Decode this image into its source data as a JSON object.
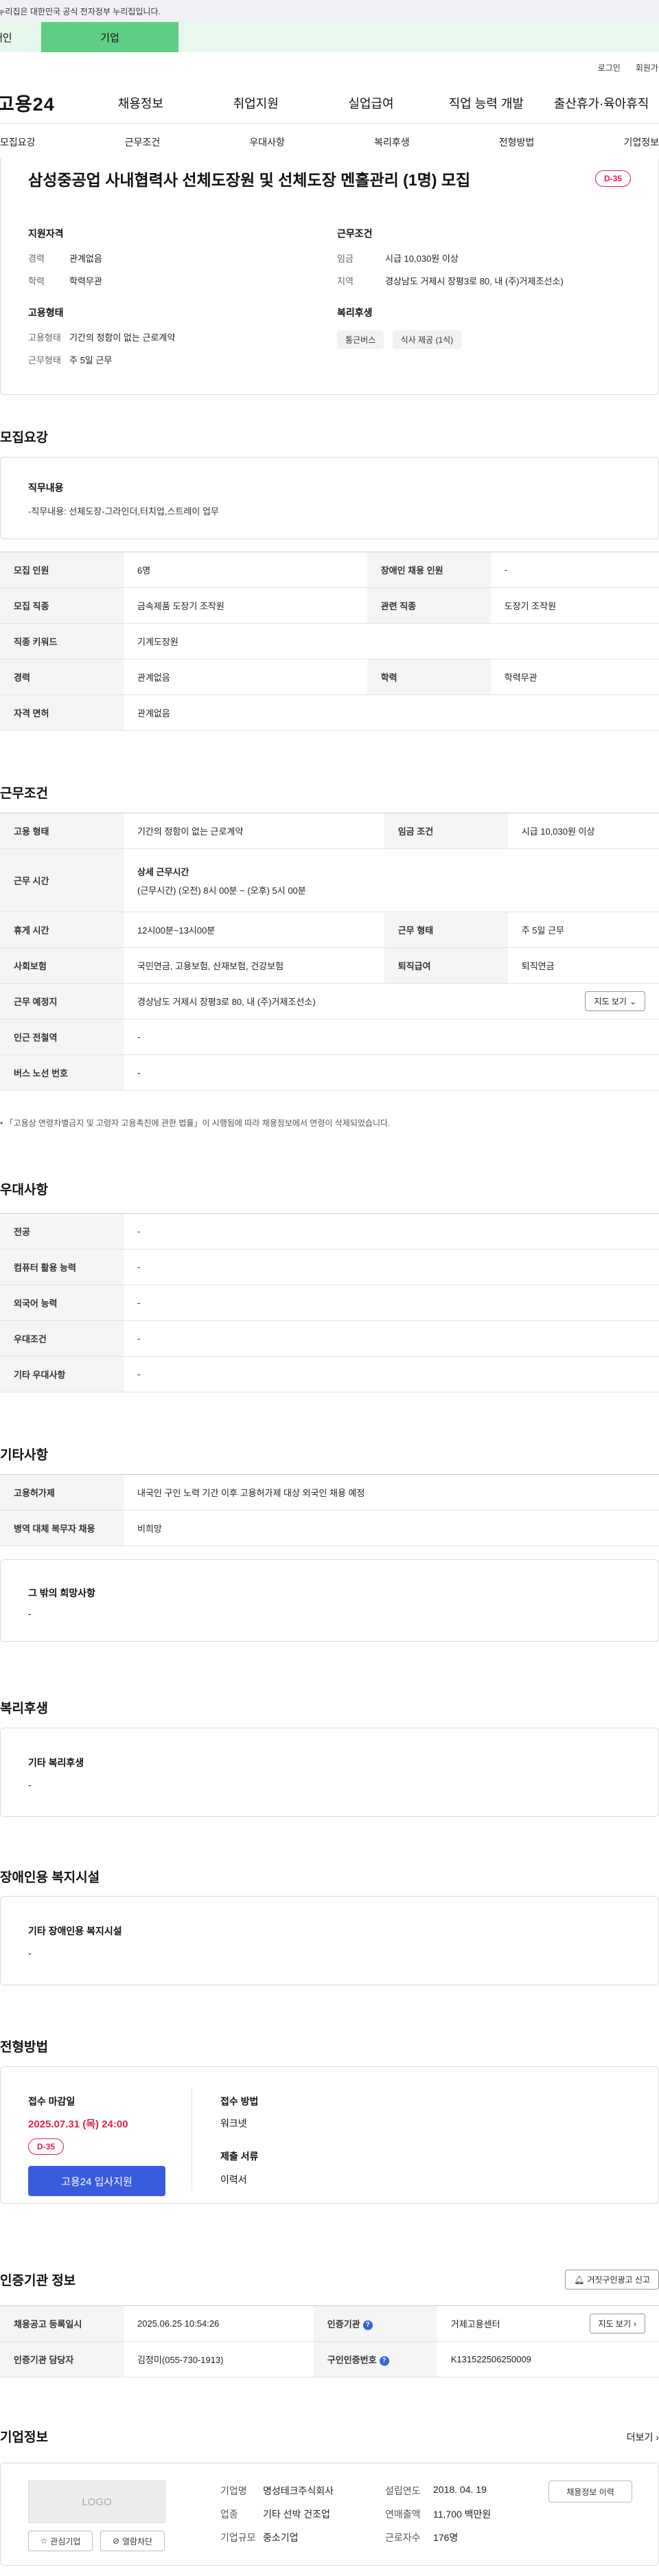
{
  "gov_banner": "이 누리집은 대한민국 공식 전자정부 누리집입니다.",
  "tabs": {
    "individual": "개인",
    "company": "기업"
  },
  "util": {
    "login": "로그인",
    "join": "회원가입"
  },
  "logo": "고용24",
  "gnb": [
    "채용정보",
    "취업지원",
    "실업급여",
    "직업 능력 개발",
    "출산휴가·육아휴직"
  ],
  "subnav": [
    "모집요강",
    "근무조건",
    "우대사항",
    "복리후생",
    "전형방법",
    "기업정보"
  ],
  "summary": {
    "title": "삼성중공업 사내협력사 선체도장원 및 선체도장 멘홀관리 (1명) 모집",
    "dday": "D-35",
    "qual": {
      "heading": "지원자격",
      "career_k": "경력",
      "career_v": "관계없음",
      "edu_k": "학력",
      "edu_v": "학력무관"
    },
    "cond": {
      "heading": "근무조건",
      "wage_k": "임금",
      "wage_v": "시급 10,030원 이상",
      "region_k": "지역",
      "region_v": "경상남도 거제시 장평3로 80, 내 (주)거제조선소)"
    },
    "emp": {
      "heading": "고용형태",
      "type_k": "고용형태",
      "type_v": "기간의 정함이 없는 근로계약",
      "work_k": "근무형태",
      "work_v": "주 5일 근무"
    },
    "welfare": {
      "heading": "복리후생",
      "chips": [
        "통근버스",
        "식사 제공 (1식)"
      ]
    }
  },
  "recruit": {
    "heading": "모집요강",
    "duty_label": "직무내용",
    "duty_text": "-직무내용: 선체도장-그라인더,터치업,스트레이 업무",
    "rows": [
      [
        "모집 인원",
        "6명",
        "장애인 채용 인원",
        "-"
      ],
      [
        "모집 직종",
        "금속제품 도장기 조작원",
        "관련 직종",
        "도장기 조작원"
      ],
      [
        "직종 키워드",
        "기계도장원"
      ],
      [
        "경력",
        "관계없음",
        "학력",
        "학력무관"
      ],
      [
        "자격 면허",
        "관계없음"
      ]
    ]
  },
  "work": {
    "heading": "근무조건",
    "r1": [
      "고용 형태",
      "기간의 정함이 없는 근로계약",
      "임금 조건",
      "시급 10,030원 이상"
    ],
    "r2_k": "근무 시간",
    "r2_sub": "상세 근무시간",
    "r2_v": "(근무시간) (오전) 8시 00분 ~ (오후) 5시 00분",
    "r3": [
      "휴게 시간",
      "12시00분~13시00분",
      "근무 형태",
      "주 5일 근무"
    ],
    "r4": [
      "사회보험",
      "국민연금, 고용보험, 산재보험, 건강보험",
      "퇴직급여",
      "퇴직연금"
    ],
    "r5_k": "근무 예정지",
    "r5_v": "경상남도 거제시 장평3로 80, 내 (주)거제조선소)",
    "map_btn": "지도 보기",
    "r6": [
      "인근 전철역",
      "-"
    ],
    "r7": [
      "버스 노선 번호",
      "-"
    ],
    "note": "「고용상 연령차별금지 및 고령자 고용촉진에 관한 법률」이 시행됨에 따라 채용정보에서 연령이 삭제되었습니다."
  },
  "pref": {
    "heading": "우대사항",
    "rows": [
      [
        "전공",
        "-"
      ],
      [
        "컴퓨터 활용 능력",
        "-"
      ],
      [
        "외국어 능력",
        "-"
      ],
      [
        "우대조건",
        "-"
      ],
      [
        "기타 우대사항",
        "-"
      ]
    ]
  },
  "etc": {
    "heading": "기타사항",
    "rows": [
      [
        "고용허가제",
        "내국인 구인 노력 기간 이후 고용허가제 대상 외국인 채용 예정"
      ],
      [
        "병역 대체 복무자 채용",
        "비희망"
      ]
    ],
    "box_label": "그 밖의 희망사항",
    "box_value": "-"
  },
  "benefit": {
    "heading": "복리후생",
    "box_label": "기타 복리후생",
    "box_value": "-"
  },
  "disabled": {
    "heading": "장애인용 복지시설",
    "box_label": "기타 장애인용 복지시설",
    "box_value": "-"
  },
  "process": {
    "heading": "전형방법",
    "deadline_label": "접수 마감일",
    "deadline": "2025.07.31 (목) 24:00",
    "dday": "D-35",
    "apply_btn": "고용24 입사지원",
    "method_label": "접수 방법",
    "method": "워크넷",
    "docs_label": "제출 서류",
    "docs": "이력서"
  },
  "cert": {
    "heading": "인증기관 정보",
    "report_btn": "거짓구인광고 신고",
    "r1": [
      "채용공고 등록일시",
      "2025.06.25 10:54:26",
      "인증기관",
      "거제고용센터"
    ],
    "r2": [
      "인증기관 담당자",
      "김정미(055-730-1913)",
      "구인인증번호",
      "K131522506250009"
    ],
    "map_btn": "지도 보기"
  },
  "company": {
    "heading": "기업정보",
    "more": "더보기",
    "logo": "LOGO",
    "fav_btn": "관심기업",
    "block_btn": "열람차단",
    "history_btn": "채용정보 이력",
    "rows": [
      [
        "기업명",
        "명성테크주식회사",
        "설립연도",
        "2018. 04. 19"
      ],
      [
        "업종",
        "기타 선박 건조업",
        "연매출액",
        "11,700 백만원"
      ],
      [
        "기업규모",
        "중소기업",
        "근로자수",
        "176명"
      ]
    ]
  },
  "colors": {
    "accent": "#3a5cdc",
    "dday": "#e0204d",
    "green": "#5fcd84"
  }
}
